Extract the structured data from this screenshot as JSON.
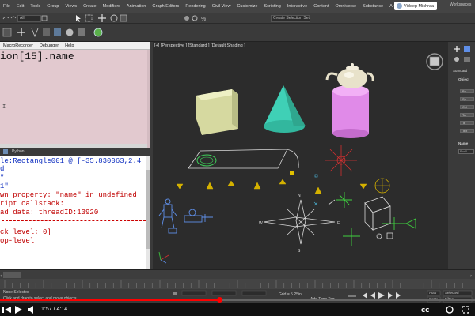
{
  "menu": {
    "items": [
      "File",
      "Edit",
      "Tools",
      "Group",
      "Views",
      "Create",
      "Modifiers",
      "Animation",
      "Graph Editors",
      "Rendering",
      "Civil View",
      "Customize",
      "Scripting",
      "Interactive",
      "Content",
      "Omniverse",
      "Substance",
      "Arnold"
    ],
    "user_name": "Videep Mishraa",
    "workspace": "Workspaces"
  },
  "toolbar": {
    "filter_dropdown": "All",
    "selection_set": "Create Selection Set"
  },
  "listener": {
    "menu_items": [
      "MacroRecorder",
      "Debugger",
      "Help"
    ],
    "input_text": "ion[15].name",
    "cursor": "I"
  },
  "python": {
    "tab_label": "Python",
    "lines": [
      "le:Rectangle001 @ [-35.830063,2.4",
      "d",
      "\"",
      "1\"",
      "wn property: \"name\" in undefined",
      "ript callstack:",
      "ad data: threadID:13920",
      "ck level: 0]",
      "op-level"
    ]
  },
  "viewport": {
    "label": "[+] [Perspective ] [Standard ] [Default Shading ]",
    "compass": {
      "north": "N",
      "west": "W",
      "east": "E",
      "south": "S"
    }
  },
  "command_panel": {
    "dropdown": "Standard",
    "rollout_title": "Object",
    "buttons": [
      "Bo",
      "Sp",
      "Cyl",
      "Tor",
      "Te",
      "Tex"
    ],
    "name_rollout": "Name",
    "field_value": "Box0"
  },
  "status": {
    "selection": "None Selected",
    "hint": "Click and drag to select and move objects",
    "grid": "Grid = 5.25in",
    "add_time_tag": "Add Time Tag",
    "auto": "Auto",
    "set_key": "Set K.",
    "selected": "Selected",
    "key_filters": "Filters..."
  },
  "player": {
    "time_current": "1:57",
    "time_total": "4:14",
    "time_display": "1:57 / 4:14",
    "progress": 0.461
  },
  "colors": {
    "listener_bg": "#e2c9cf",
    "viewport_bg": "#2c2c2c",
    "progress": "#ff0000",
    "box": "#e2e5b0",
    "cone": "#3fd0b6",
    "cylinder": "#e08ae8"
  }
}
